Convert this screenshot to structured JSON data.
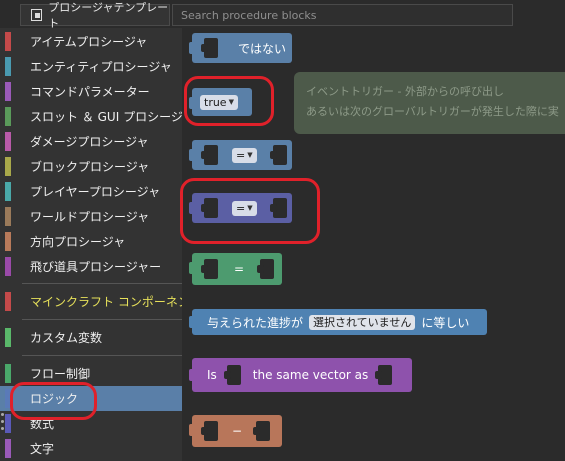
{
  "toolbar": {
    "template_button": "プロシージャテンプレート",
    "template_icon": "template-icon",
    "search_placeholder": "Search procedure blocks"
  },
  "sidebar": {
    "items": [
      {
        "label": "アイテムプロシージャ",
        "color": "#c44a4a"
      },
      {
        "label": "エンティティプロシージャ",
        "color": "#4a9ab0"
      },
      {
        "label": "コマンドパラメーター",
        "color": "#9a5ab8"
      },
      {
        "label": "スロット ＆ GUI プロシージャ",
        "color": "#5a9a5a"
      },
      {
        "label": "ダメージプロシージャ",
        "color": "#b85aa8"
      },
      {
        "label": "ブロックプロシージャ",
        "color": "#a8a84a"
      },
      {
        "label": "プレイヤープロシージャ",
        "color": "#4aa8a8"
      },
      {
        "label": "ワールドプロシージャ",
        "color": "#9a7a5a"
      },
      {
        "label": "方向プロシージャ",
        "color": "#b87a5a"
      },
      {
        "label": "飛び道具プロシージャー",
        "color": "#9a4aa8"
      },
      {
        "label": "マインクラフト コンポーネント",
        "color": "#c44a4a"
      },
      {
        "label": "カスタム変数",
        "color": "#5ab86a"
      },
      {
        "label": "フロー制御",
        "color": "#4aa86a"
      },
      {
        "label": "ロジック",
        "color": "#5a7ab8"
      },
      {
        "label": "数式",
        "color": "#5a5ab8"
      },
      {
        "label": "文字",
        "color": "#9a5ab8"
      }
    ],
    "selected": "ロジック"
  },
  "blocks": {
    "not_label": "ではない",
    "true_value": "true",
    "eq_op": "=",
    "eq_op2": "=",
    "eq_plain": "=",
    "advancement_prefix": "与えられた進捗が",
    "advancement_value": "選択されていません",
    "advancement_suffix": "に等しい",
    "vector_is": "Is",
    "vector_label": "the same vector as",
    "minus_op": "−"
  },
  "comment": {
    "line1": "イベントトリガー - 外部からの呼び出し",
    "line2": "あるいは次のグローバルトリガーが発生した際に実"
  },
  "colors": {
    "logic_blue": "#5a80a8",
    "logic_purple": "#5b5fa4",
    "green": "#4d9b6f",
    "vector_purple": "#8e52ac",
    "math_orange": "#b8765a",
    "advancement_blue": "#4f82b2",
    "highlight_red": "#e0212a"
  }
}
